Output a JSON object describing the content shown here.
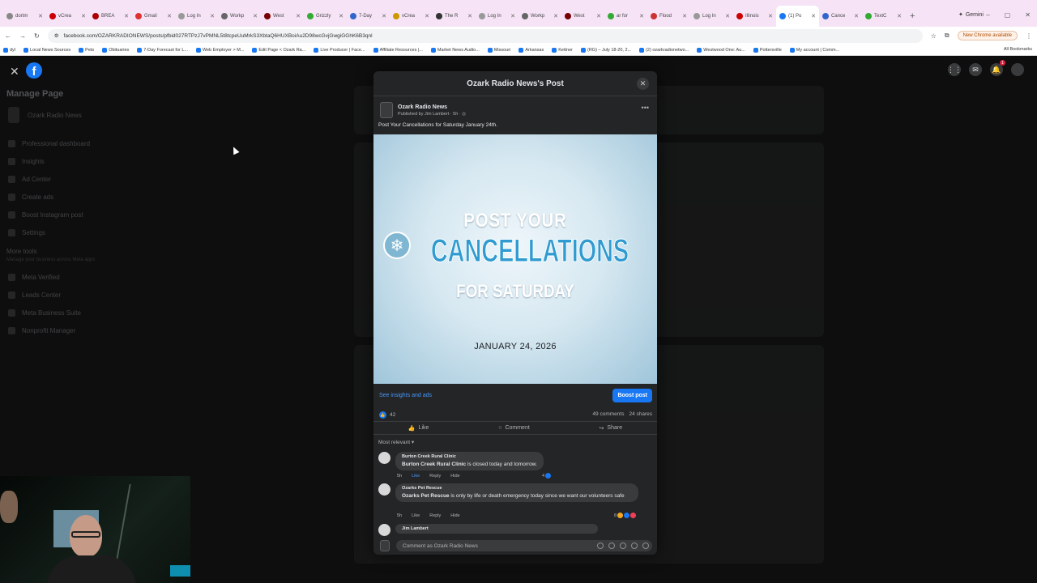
{
  "browser": {
    "tabs": [
      {
        "label": "dortm",
        "color": "#888"
      },
      {
        "label": "vCrea",
        "color": "#c00"
      },
      {
        "label": "BREA",
        "color": "#a00"
      },
      {
        "label": "Gmail",
        "color": "#d33"
      },
      {
        "label": "Log In",
        "color": "#999"
      },
      {
        "label": "Workp",
        "color": "#666"
      },
      {
        "label": "West",
        "color": "#700"
      },
      {
        "label": "Grizzly",
        "color": "#3a3"
      },
      {
        "label": "7-Day",
        "color": "#36c"
      },
      {
        "label": "vCrea",
        "color": "#c90"
      },
      {
        "label": "The R",
        "color": "#333"
      },
      {
        "label": "Log In",
        "color": "#999"
      },
      {
        "label": "Workp",
        "color": "#666"
      },
      {
        "label": "West",
        "color": "#700"
      },
      {
        "label": "ar for",
        "color": "#3a3"
      },
      {
        "label": "Flood",
        "color": "#c33"
      },
      {
        "label": "Log In",
        "color": "#999"
      },
      {
        "label": "Illinois",
        "color": "#c00"
      },
      {
        "label": "(1) Po",
        "color": "#1877f2"
      },
      {
        "label": "Cance",
        "color": "#36c"
      },
      {
        "label": "TextC",
        "color": "#3a3"
      }
    ],
    "gemini_label": "Gemini",
    "url": "facebook.com/OZARKRADIONEWS/posts/pfbid027RTPzJ7vPMNL5t8tcpeUuMrkS3XbtaQ6HUXBoiAu2D98wcGvjGwgiGGhK6B3qnl",
    "chrome_available": "New Chrome available",
    "bookmarks": [
      "dyl",
      "Local News Sources",
      "Pets",
      "Obituaries",
      "7-Day Forecast for L...",
      "Web Employer > M...",
      "Edit Page < Ozark Ra...",
      "Live Producer | Face...",
      "Affiliate Resources |...",
      "Market News Audio...",
      "Missouri",
      "Arkansas",
      "Kettner",
      "(RG) – July 18-20, 2...",
      "(2) ozarkradionetwo...",
      "Westwood One: Au...",
      "Pottersville",
      "My account | Comm..."
    ],
    "all_bookmarks": "All Bookmarks"
  },
  "sidebar": {
    "title": "Manage Page",
    "page_name": "Ozark Radio News",
    "items": [
      "Professional dashboard",
      "Insights",
      "Ad Center",
      "Create ads",
      "Boost Instagram post",
      "Settings"
    ],
    "more_tools": "More tools",
    "more_tools_sub": "Manage your business across Meta apps",
    "tools": [
      "Meta Verified",
      "Leads Center",
      "Meta Business Suite",
      "Nonprofit Manager"
    ]
  },
  "modal": {
    "title": "Ozark Radio News's Post",
    "author": "Ozark Radio News",
    "meta": "Published by Jim Lambert · 5h ·",
    "post_text": "Post Your Cancellations for Saturday January 24th.",
    "image": {
      "line1": "POST YOUR",
      "line2": "CANCELLATIONS",
      "line3": "FOR SATURDAY",
      "date": "JANUARY 24, 2026"
    },
    "insights_link": "See insights and ads",
    "boost_label": "Boost post",
    "reaction_count": "42",
    "comments_count": "49 comments",
    "shares_count": "24 shares",
    "actions": {
      "like": "Like",
      "comment": "Comment",
      "share": "Share"
    },
    "sort_label": "Most relevant",
    "comments": [
      {
        "name": "Burton Creek Rural Clinic",
        "text_bold": "Burton Creek Rural Clinic",
        "text": " is closed today and tomorrow.",
        "time": "5h",
        "like": "Like",
        "reply": "Reply",
        "hide": "Hide",
        "reacts": "4"
      },
      {
        "name": "Ozarks Pet Rescue",
        "text_bold": "Ozarks Pet Rescue",
        "text": " is only by life or death emergency today since we want our volunteers safe",
        "time": "5h",
        "like": "Like",
        "reply": "Reply",
        "hide": "Hide",
        "reacts": "8"
      },
      {
        "name": "Jim Lambert",
        "text_bold": "",
        "text": ""
      }
    ],
    "comment_placeholder": "Comment as Ozark Radio News"
  }
}
